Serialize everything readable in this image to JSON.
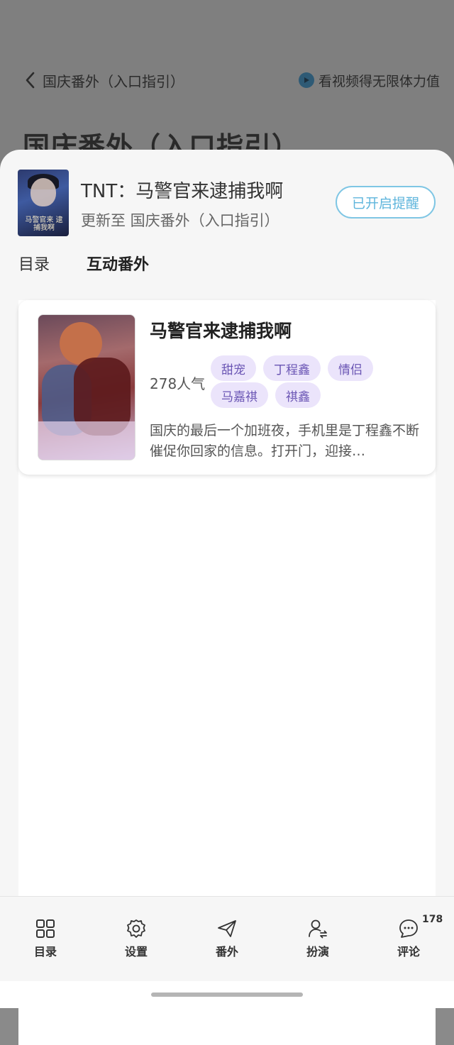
{
  "background": {
    "back_label": "国庆番外（入口指引）",
    "video_label": "看视频得无限体力值",
    "title": "国庆番外（入口指引）"
  },
  "sheet": {
    "book_title": "TNT：马警官来逮捕我啊",
    "update_text": "更新至 国庆番外（入口指引）",
    "reminder_label": "已开启提醒",
    "cover_text": "马警官来 逮捕我啊",
    "tabs": [
      {
        "label": "目录",
        "active": false
      },
      {
        "label": "互动番外",
        "active": true
      }
    ]
  },
  "card": {
    "title": "马警官来逮捕我啊",
    "popularity": "278人气",
    "tags": [
      "甜宠",
      "丁程鑫",
      "情侣",
      "马嘉祺",
      "祺鑫"
    ],
    "description": "国庆的最后一个加班夜，手机里是丁程鑫不断催促你回家的信息。打开门，迎接…"
  },
  "bottom_nav": {
    "items": [
      {
        "label": "目录",
        "icon": "grid-icon"
      },
      {
        "label": "设置",
        "icon": "gear-icon"
      },
      {
        "label": "番外",
        "icon": "paper-plane-icon"
      },
      {
        "label": "扮演",
        "icon": "user-switch-icon"
      },
      {
        "label": "评论",
        "icon": "comment-icon"
      }
    ],
    "comment_count": "178"
  },
  "colors": {
    "accent_blue": "#5fb5dc",
    "tag_bg": "#ebe4fb",
    "tag_text": "#6a55b4"
  }
}
